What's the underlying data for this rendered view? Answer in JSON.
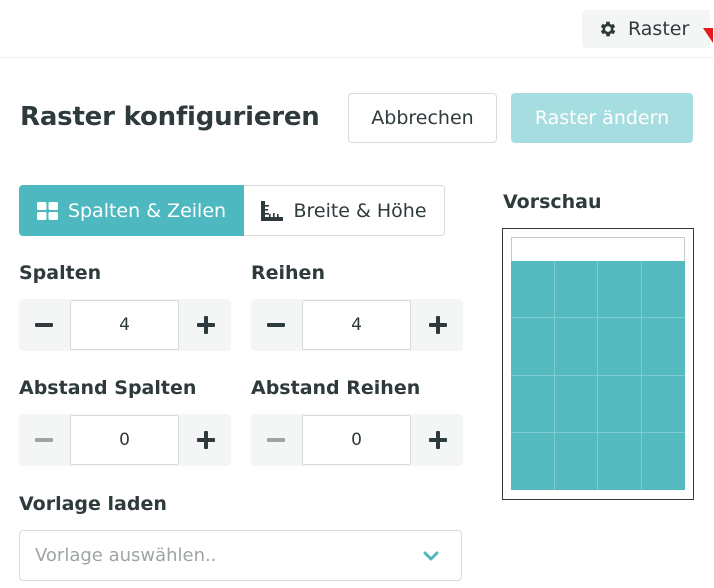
{
  "topbar": {
    "raster_button_label": "Raster"
  },
  "header": {
    "title": "Raster konfigurieren",
    "cancel_label": "Abbrechen",
    "change_label": "Raster ändern"
  },
  "tabs": [
    {
      "label": "Spalten & Zeilen",
      "icon": "grid-icon",
      "active": true
    },
    {
      "label": "Breite & Höhe",
      "icon": "ruler-icon",
      "active": false
    }
  ],
  "fields": {
    "columns": {
      "label": "Spalten",
      "value": "4"
    },
    "rows": {
      "label": "Reihen",
      "value": "4"
    },
    "column_gap": {
      "label": "Abstand Spalten",
      "value": "0"
    },
    "row_gap": {
      "label": "Abstand Reihen",
      "value": "0"
    }
  },
  "template": {
    "label": "Vorlage laden",
    "placeholder": "Vorlage auswählen.."
  },
  "preview": {
    "label": "Vorschau",
    "columns": 4,
    "rows": 4
  },
  "colors": {
    "accent": "#4db8bf",
    "accent_disabled": "#a6dde0",
    "preview_fill": "#55babf",
    "text": "#2f3a3d"
  }
}
